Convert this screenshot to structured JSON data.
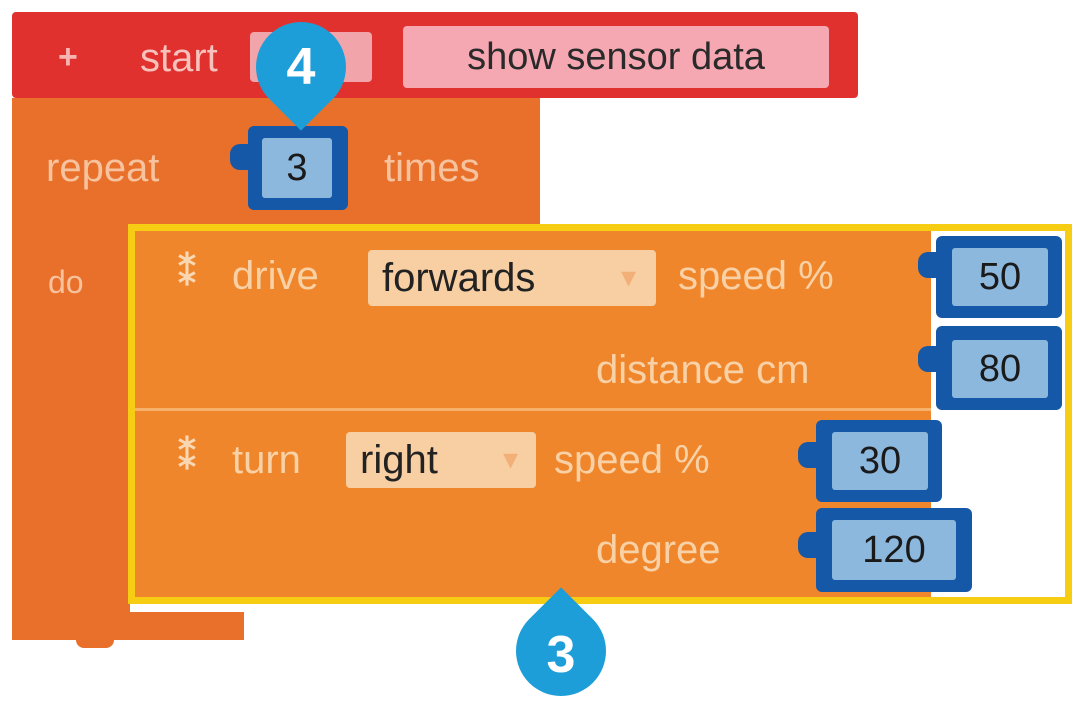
{
  "start_block": {
    "plus_icon": "+",
    "label": "start",
    "program_name": "show sensor data"
  },
  "repeat_block": {
    "label": "repeat",
    "count": "3",
    "times_label": "times",
    "do_label": "do"
  },
  "drive_block": {
    "label": "drive",
    "direction": "forwards",
    "speed_label": "speed %",
    "speed_value": "50",
    "distance_label": "distance cm",
    "distance_value": "80"
  },
  "turn_block": {
    "label": "turn",
    "direction": "right",
    "speed_label": "speed %",
    "speed_value": "30",
    "degree_label": "degree",
    "degree_value": "120"
  },
  "callouts": {
    "top": "4",
    "bottom": "3"
  },
  "colors": {
    "start_red": "#e0312f",
    "repeat_orange": "#e9702b",
    "motion_orange": "#f0862b",
    "socket_blue": "#1558a8",
    "highlight_yellow": "#f6cd12",
    "callout_blue": "#1e9ed8"
  },
  "icons": {
    "grip": "grip-icon",
    "dropdown": "chevron-down-icon",
    "callout": "callout-marker-icon"
  }
}
